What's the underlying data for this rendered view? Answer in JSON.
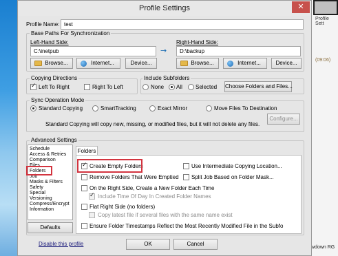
{
  "background": {
    "window_text": "Profile Sett",
    "date_text": "(09:06)",
    "bottom_text": "wdown RG"
  },
  "dialog": {
    "title": "Profile Settings",
    "close_glyph": "✕",
    "profile_name_label": "Profile Name:",
    "profile_name_value": "test",
    "base_paths_label": "Base Paths For Synchronization",
    "left_side_label": "Left-Hand Side:",
    "left_path": "C:\\inetpub",
    "right_side_label": "Right-Hand Side:",
    "right_path": "D:\\backup",
    "arrow": "→",
    "browse": "Browse...",
    "internet": "Internet...",
    "device": "Device...",
    "copying_directions": {
      "label": "Copying Directions",
      "left_to_right": "Left To Right",
      "right_to_left": "Right To Left"
    },
    "include_subfolders": {
      "label": "Include Subfolders",
      "none": "None",
      "all": "All",
      "selected": "Selected",
      "choose_button": "Choose Folders and Files..."
    },
    "sync_mode": {
      "label": "Sync Operation Mode",
      "standard": "Standard Copying",
      "smart": "SmartTracking",
      "exact": "Exact Mirror",
      "move": "Move Files To Destination",
      "configure": "Configure...",
      "description": "Standard Copying will copy new, missing, or modified files, but it will not delete any files."
    },
    "advanced": {
      "label": "Advanced Settings",
      "categories": [
        "Schedule",
        "Access & Retries",
        "Comparison",
        "Files",
        "Folders",
        "Job",
        "Masks & Filters",
        "Safety",
        "Special",
        "Versioning",
        "Compress/Encrypt",
        "Information"
      ],
      "selected": "Folders",
      "defaults_button": "Defaults",
      "tab": "Folders",
      "options": {
        "create_empty": "Create Empty Folders",
        "remove_empty": "Remove Folders That Were Emptied",
        "right_new_folder": "On the Right Side, Create a New Folder Each Time",
        "include_time": "Include Time Of Day In Created Folder Names",
        "flat_right": "Flat Right Side (no folders)",
        "copy_latest": "Copy latest file if several files with the same name exist",
        "ensure_ts": "Ensure Folder Timestamps Reflect the Most Recently Modified File in the Subfo",
        "intermediate": "Use Intermediate Copying Location...",
        "split_job": "Split Job Based on Folder Mask..."
      }
    },
    "disable_link": "Disable this profile",
    "ok": "OK",
    "cancel": "Cancel"
  }
}
